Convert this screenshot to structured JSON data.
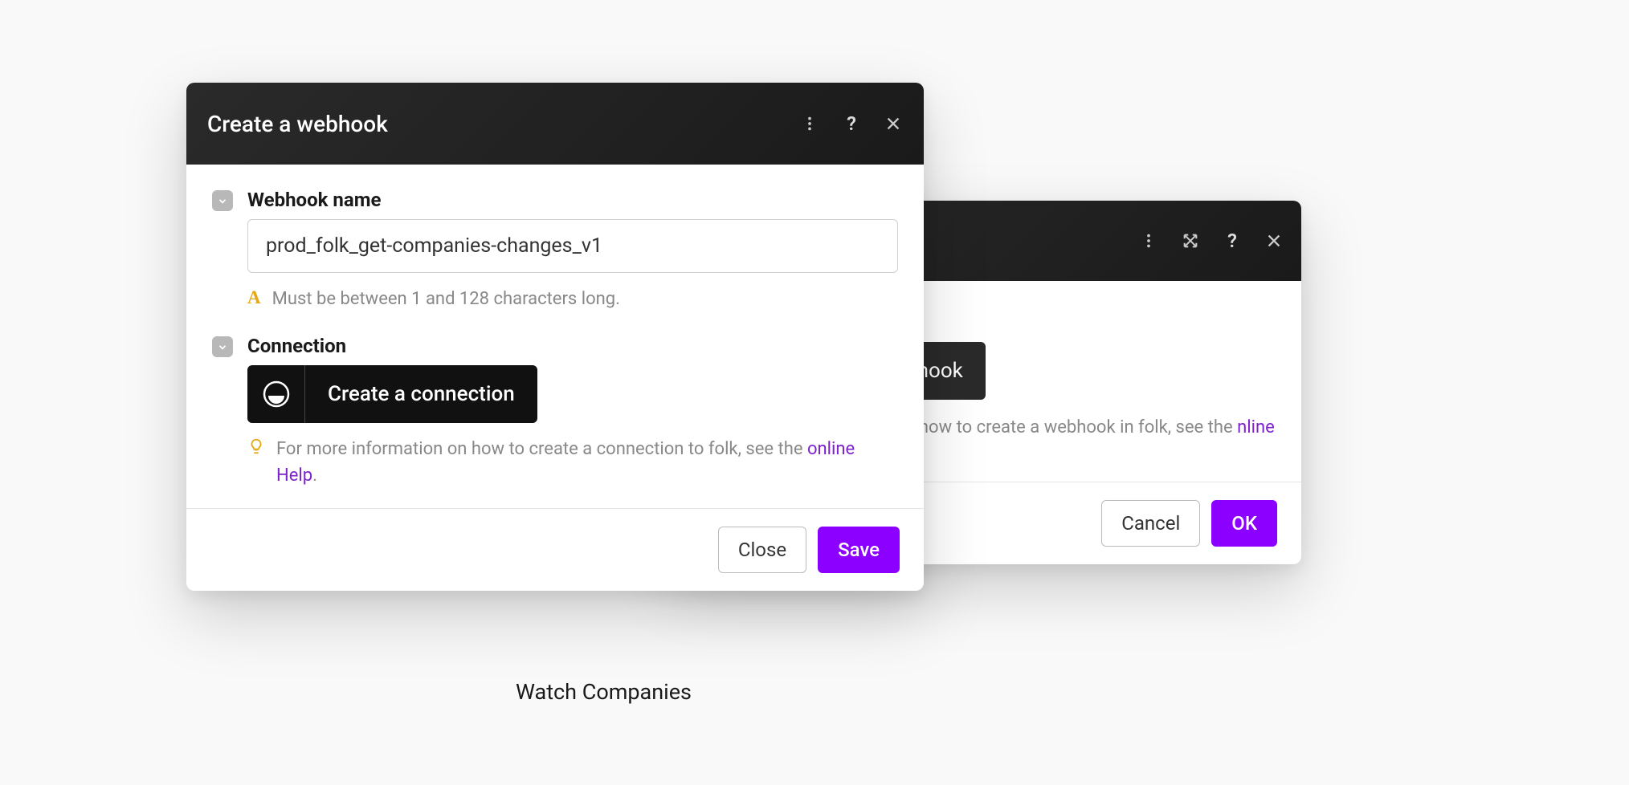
{
  "background": {
    "watch_label": "Watch Companies"
  },
  "back_modal": {
    "section_label": "hook",
    "create_webhook_button": "Create a webhook",
    "hint_text_prefix": "or more information on how to create a webhook in folk, see the ",
    "hint_link": "nline Help",
    "hint_text_suffix": ".",
    "cancel_button": "Cancel",
    "ok_button": "OK"
  },
  "front_modal": {
    "title": "Create a webhook",
    "webhook_name_label": "Webhook name",
    "webhook_name_value": "prod_folk_get-companies-changes_v1",
    "webhook_name_hint": "Must be between 1 and 128 characters long.",
    "connection_label": "Connection",
    "create_connection_button": "Create a connection",
    "connection_hint_prefix": "For more information on how to create a connection to folk, see the ",
    "connection_hint_link": "online Help",
    "connection_hint_suffix": ".",
    "close_button": "Close",
    "save_button": "Save"
  }
}
